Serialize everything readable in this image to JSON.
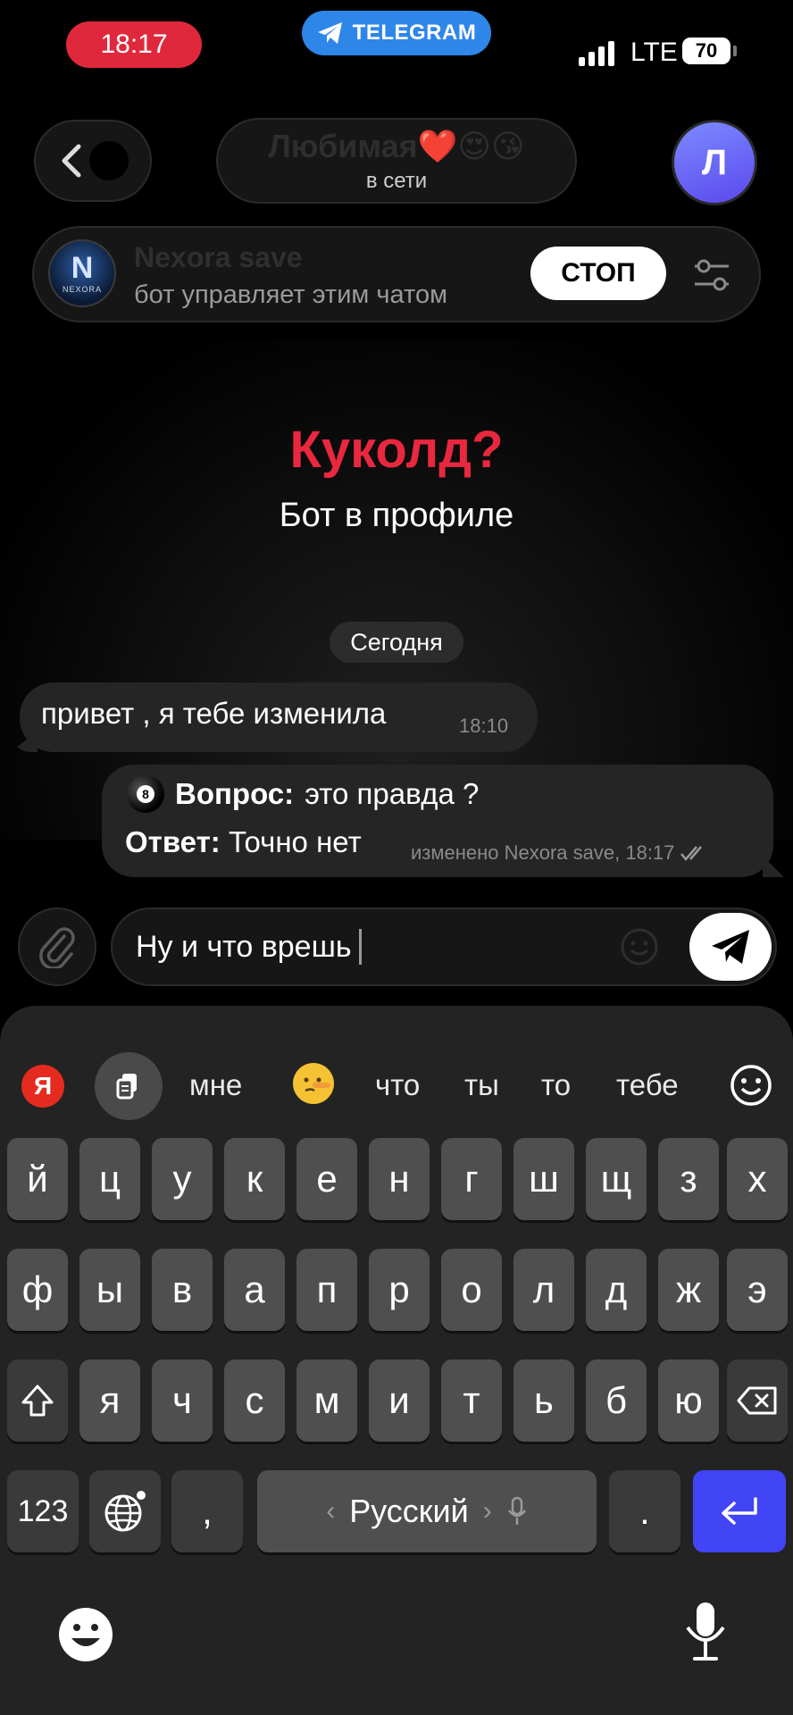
{
  "status_bar": {
    "time": "18:17",
    "app_pill": "TELEGRAM",
    "network": "LTE",
    "battery": "70"
  },
  "header": {
    "chat_name": "Любимая❤️😍😘",
    "status": "в сети",
    "avatar_letter": "Л"
  },
  "bot_bar": {
    "name": "Nexora save",
    "subtitle": "бот управляет этим чатом",
    "stop_label": "СТОП",
    "avatar_text": "N",
    "avatar_caption": "NEXORA"
  },
  "promo": {
    "title": "Куколд?",
    "subtitle": "Бот в профиле"
  },
  "date_chip": "Сегодня",
  "messages": {
    "incoming": {
      "text": "привет , я тебе изменила",
      "time": "18:10"
    },
    "outgoing": {
      "question_label": "Вопрос:",
      "question_text": "это правда ?",
      "answer_label": "Ответ:",
      "answer_text": "Точно нет",
      "meta": "изменено Nexora save, 18:17",
      "ball_number": "8"
    }
  },
  "composer": {
    "text": "Ну и что врешь"
  },
  "keyboard": {
    "brand": "Я",
    "suggestions": [
      "мне",
      "что",
      "ты",
      "то",
      "тебе"
    ],
    "suggestion_emoji": "🤥",
    "row1": [
      "й",
      "ц",
      "у",
      "к",
      "е",
      "н",
      "г",
      "ш",
      "щ",
      "з",
      "х"
    ],
    "row2": [
      "ф",
      "ы",
      "в",
      "а",
      "п",
      "р",
      "о",
      "л",
      "д",
      "ж",
      "э"
    ],
    "row3": [
      "я",
      "ч",
      "с",
      "м",
      "и",
      "т",
      "ь",
      "б",
      "ю"
    ],
    "numbers_key": "123",
    "comma_key": ",",
    "space_label": "Русский",
    "period_key": "."
  },
  "colors": {
    "time_pill": "#e0283c",
    "telegram_pill": "#2f86e9",
    "promo_title": "#e8283e",
    "enter_key": "#4145f5",
    "bubble": "#252525"
  }
}
